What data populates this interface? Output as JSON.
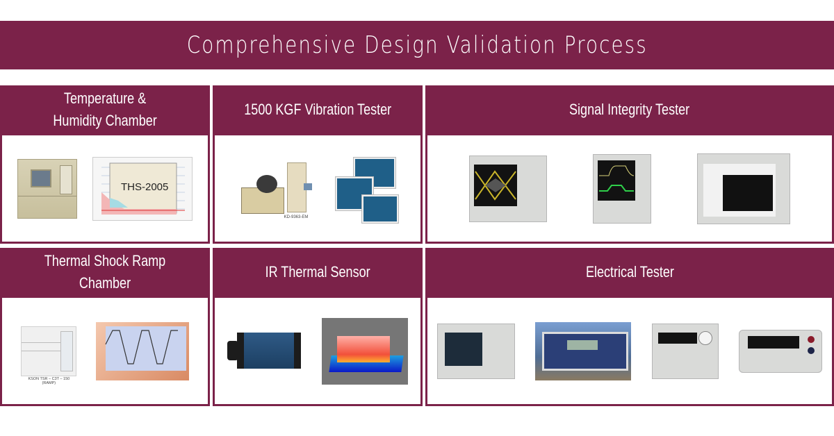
{
  "page_title": "Comprehensive Design Validation Process",
  "colors": {
    "brand": "#7b2249",
    "panel_bg": "#ffffff"
  },
  "cards": [
    {
      "title": "Temperature &\nHumidity Chamber",
      "images": [
        {
          "name": "temperature-humidity-chamber-photo"
        },
        {
          "name": "ths-performance-chart",
          "label": "THS-2005"
        }
      ]
    },
    {
      "title": "1500 KGF Vibration Tester",
      "images": [
        {
          "name": "vibration-tester-photo",
          "caption": "KD-9363-EM"
        },
        {
          "name": "vibration-analysis-screens"
        }
      ]
    },
    {
      "title": "Signal Integrity Tester",
      "images": [
        {
          "name": "eye-diagram-oscilloscope"
        },
        {
          "name": "digital-oscilloscope"
        },
        {
          "name": "logic-analyzer"
        }
      ]
    },
    {
      "title": "Thermal Shock Ramp Chamber",
      "images": [
        {
          "name": "thermal-shock-chamber-photo",
          "caption": "KSON TSR – C3T – 150 (RAMP)"
        },
        {
          "name": "temperature-cycle-chart"
        }
      ]
    },
    {
      "title": "IR Thermal Sensor",
      "images": [
        {
          "name": "ir-camera-photo"
        },
        {
          "name": "thermal-map-image"
        }
      ]
    },
    {
      "title": "Electrical Tester",
      "images": [
        {
          "name": "mixed-signal-oscilloscope"
        },
        {
          "name": "power-analyzer"
        },
        {
          "name": "dc-power-supply"
        },
        {
          "name": "digital-multimeter"
        }
      ]
    }
  ]
}
